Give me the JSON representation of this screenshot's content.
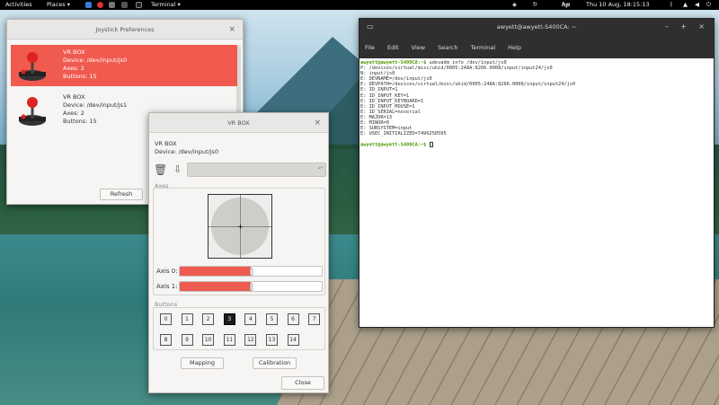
{
  "topbar": {
    "activities": "Activities",
    "places": "Places ▾",
    "terminal": "Terminal ▾",
    "lang": "fr",
    "clock": "Thu 10 Aug, 18:15:13"
  },
  "joystick_prefs": {
    "title": "Joystick Preferences",
    "devices": [
      {
        "name": "VR BOX",
        "device": "Device: /dev/input/js0",
        "axes": "Axes: 2",
        "buttons": "Buttons: 15",
        "selected": true
      },
      {
        "name": "VR BOX",
        "device": "Device: /dev/input/js1",
        "axes": "Axes: 2",
        "buttons": "Buttons: 15",
        "selected": false
      }
    ],
    "refresh_label": "Refresh"
  },
  "vrbox": {
    "title": "VR BOX",
    "name": "VR BOX",
    "device": "Device: /dev/input/js0",
    "axes_title": "Axes",
    "axis0_label": "Axis 0:",
    "axis1_label": "Axis 1:",
    "axis0_value": 0.5,
    "axis1_value": 0.5,
    "buttons_title": "Buttons",
    "buttons_row1": [
      "0",
      "1",
      "2",
      "3",
      "4",
      "5",
      "6",
      "7"
    ],
    "buttons_row2": [
      "8",
      "9",
      "10",
      "11",
      "12",
      "13",
      "14"
    ],
    "active_button": "3",
    "mapping_label": "Mapping",
    "calibration_label": "Calibration",
    "close_label": "Close"
  },
  "terminal": {
    "title": "awyett@awyett-S400CA: ~",
    "menu": [
      "File",
      "Edit",
      "View",
      "Search",
      "Terminal",
      "Help"
    ],
    "prompt": "awyett@awyett-S400CA:~$",
    "command": " udevadm info /dev/input/js0",
    "output": [
      "P: /devices/virtual/misc/uhid/0005:248A:8266.0008/input/input24/js0",
      "N: input/js0",
      "E: DEVNAME=/dev/input/js0",
      "E: DEVPATH=/devices/virtual/misc/uhid/0005:248A:8266.0008/input/input24/js0",
      "E: ID_INPUT=1",
      "E: ID_INPUT_KEY=1",
      "E: ID_INPUT_KEYBOARD=1",
      "E: ID_INPUT_MOUSE=1",
      "E: ID_SERIAL=noserial",
      "E: MAJOR=13",
      "E: MINOR=0",
      "E: SUBSYSTEM=input",
      "E: USEC_INITIALIZED=7496250595"
    ],
    "prompt2": "awyett@awyett-S400CA:~$"
  }
}
